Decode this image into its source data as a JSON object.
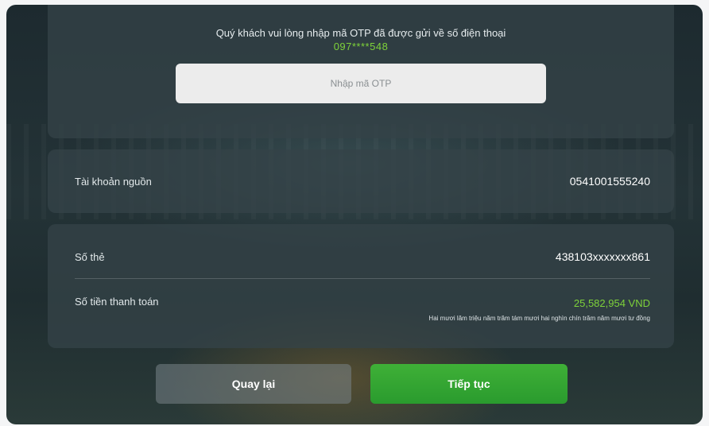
{
  "otp": {
    "message": "Quý khách vui lòng nhập mã OTP đã được gửi về số điện thoại",
    "phone": "097****548",
    "input_placeholder": "Nhập mã OTP",
    "input_value": ""
  },
  "source_account": {
    "label": "Tài khoản nguồn",
    "value": "0541001555240"
  },
  "payment": {
    "card_label": "Số thẻ",
    "card_value": "438103xxxxxxx861",
    "amount_label": "Số tiền thanh toán",
    "amount_value": "25,582,954 VND",
    "amount_in_words": "Hai mươi lăm triệu năm trăm tám mươi hai nghìn chín trăm năm mươi tư đồng"
  },
  "actions": {
    "back_label": "Quay lại",
    "next_label": "Tiếp tục"
  },
  "colors": {
    "accent_green": "#7ed23a",
    "button_green": "#2fa233",
    "card_bg": "#344248"
  }
}
